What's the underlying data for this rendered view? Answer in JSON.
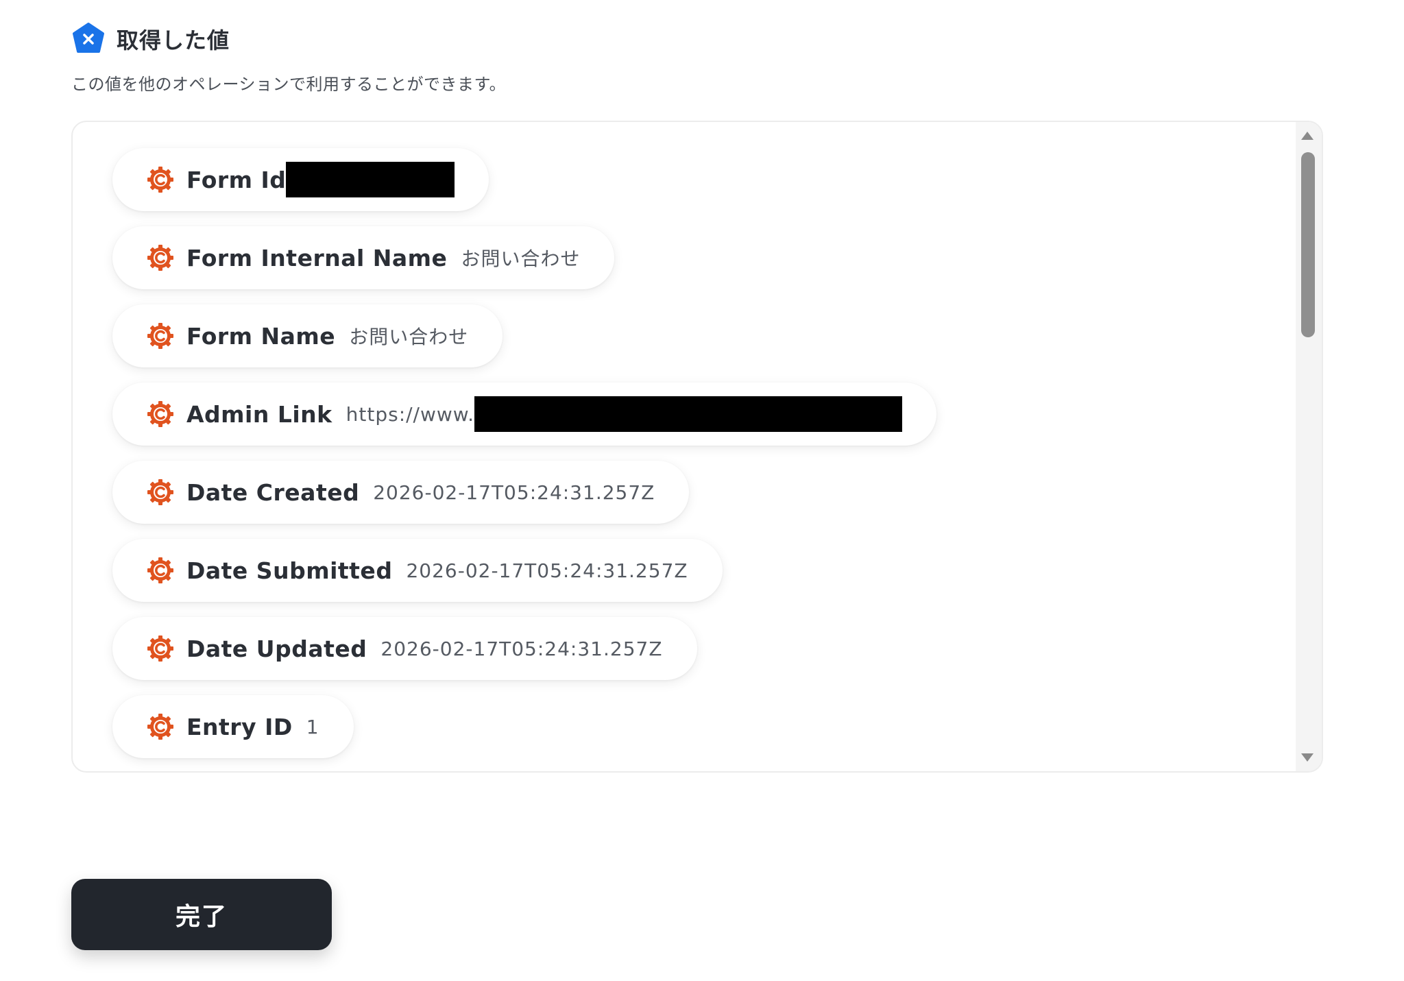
{
  "header": {
    "title": "取得した値",
    "icon": "blue-x-pentagon-icon"
  },
  "subtitle": "この値を他のオペレーションで利用することができます。",
  "fields": [
    {
      "label": "Form Id",
      "value": "",
      "redacted": true
    },
    {
      "label": "Form Internal Name",
      "value": "お問い合わせ",
      "redacted": false
    },
    {
      "label": "Form Name",
      "value": "お問い合わせ",
      "redacted": false
    },
    {
      "label": "Admin Link",
      "value": "https://www.",
      "redacted": true
    },
    {
      "label": "Date Created",
      "value": "2026-02-17T05:24:31.257Z",
      "redacted": false
    },
    {
      "label": "Date Submitted",
      "value": "2026-02-17T05:24:31.257Z",
      "redacted": false
    },
    {
      "label": "Date Updated",
      "value": "2026-02-17T05:24:31.257Z",
      "redacted": false
    },
    {
      "label": "Entry ID",
      "value": "1",
      "redacted": false
    }
  ],
  "field_icon": "orange-gear-c-icon",
  "done_button": "完了",
  "colors": {
    "accent_blue": "#1a73e8",
    "field_icon_orange": "#e0531f",
    "button_dark": "#22262d"
  }
}
